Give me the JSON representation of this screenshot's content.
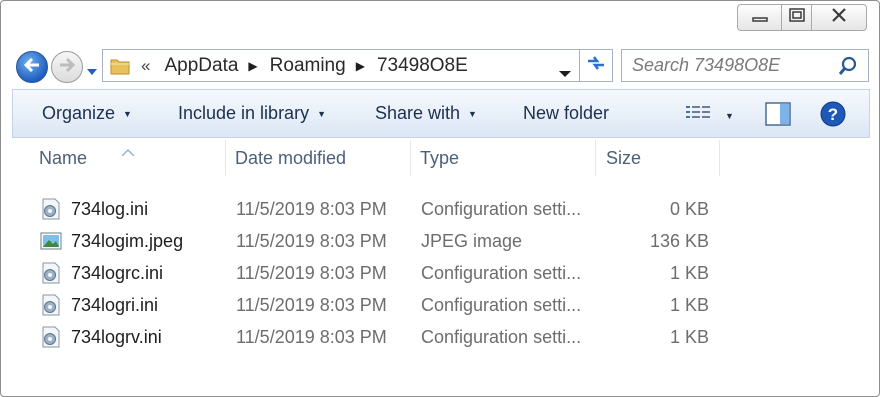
{
  "window": {
    "caption": {
      "minimize_icon": "minimize-icon",
      "maximize_icon": "restore-icon",
      "close_icon": "close-icon"
    }
  },
  "address_bar": {
    "overflow": "«",
    "crumbs": [
      "AppData",
      "Roaming",
      "73498O8E"
    ]
  },
  "search": {
    "placeholder": "Search 73498O8E"
  },
  "toolbar": {
    "organize": "Organize",
    "include_in_library": "Include in library",
    "share_with": "Share with",
    "new_folder": "New folder"
  },
  "columns": {
    "name": "Name",
    "date_modified": "Date modified",
    "type": "Type",
    "size": "Size"
  },
  "files": [
    {
      "name": "734log.ini",
      "date": "11/5/2019 8:03 PM",
      "type": "Configuration setti...",
      "size": "0 KB",
      "icon": "config-file-icon"
    },
    {
      "name": "734logim.jpeg",
      "date": "11/5/2019 8:03 PM",
      "type": "JPEG image",
      "size": "136 KB",
      "icon": "jpeg-file-icon"
    },
    {
      "name": "734logrc.ini",
      "date": "11/5/2019 8:03 PM",
      "type": "Configuration setti...",
      "size": "1 KB",
      "icon": "config-file-icon"
    },
    {
      "name": "734logri.ini",
      "date": "11/5/2019 8:03 PM",
      "type": "Configuration setti...",
      "size": "1 KB",
      "icon": "config-file-icon"
    },
    {
      "name": "734logrv.ini",
      "date": "11/5/2019 8:03 PM",
      "type": "Configuration setti...",
      "size": "1 KB",
      "icon": "config-file-icon"
    }
  ],
  "colors": {
    "toolbar_top": "#f6f9fd",
    "toolbar_bottom": "#dbe7f5",
    "accent_blue": "#1f5fbf",
    "header_text": "#4c607a"
  }
}
